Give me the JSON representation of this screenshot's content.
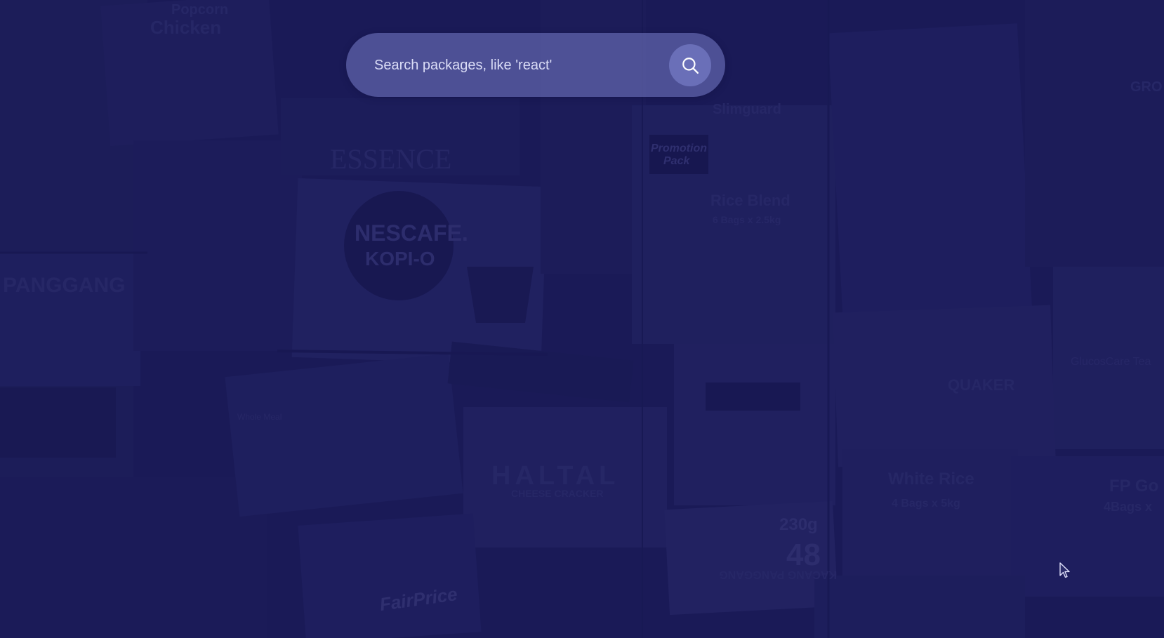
{
  "search": {
    "placeholder": "Search packages, like 'react'",
    "value": ""
  },
  "icons": {
    "search_button": "search-icon",
    "cursor": "mouse-pointer-icon"
  },
  "colors": {
    "background_tint": "#1c1d56",
    "search_bar": "#6e72bc",
    "search_button": "#6a6fb8",
    "placeholder_text": "#dadcf6"
  },
  "background_image": {
    "print_text": [
      "Popcorn",
      "Chicken",
      "ESSENCE",
      "NESCAFE.",
      "KOPI-O",
      "Promotion",
      "Pack",
      "Rice Blend",
      "6 Bags x 2.5kg",
      "Slimguard",
      "PANGGANG",
      "HALTAL",
      "CHEESE CRACKER",
      "QUAKER",
      "GlucosCare Tea",
      "White Rice",
      "4 Bags x 5kg",
      "FP Go",
      "4Bags x",
      "FairPrice",
      "48",
      "230g",
      "KACANG PANGGANG",
      "GRO",
      "Whole Meal"
    ]
  }
}
